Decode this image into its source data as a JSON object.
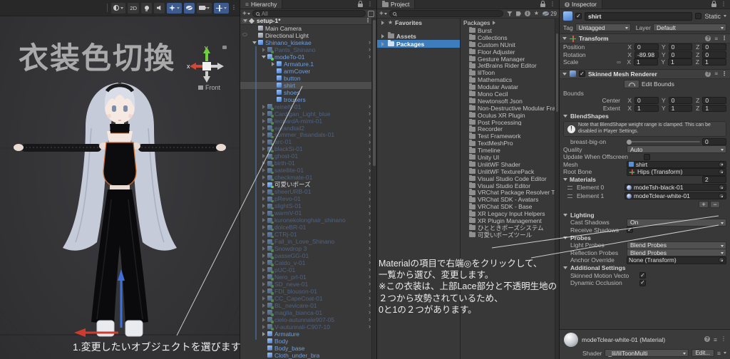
{
  "scene": {
    "title_overlay": "衣装色切換",
    "caption": "1.変更したいオブジェクトを選びます",
    "toolbar": {
      "mode_2d": "2D"
    },
    "view_gizmo": {
      "front": "Front",
      "x": "x",
      "y": "y"
    }
  },
  "hierarchy": {
    "tab": "Hierarchy",
    "search_placeholder": "All",
    "items": [
      {
        "label": "setup-1*",
        "d": 0,
        "s": "scene",
        "e": 1
      },
      {
        "label": "Main Camera",
        "d": 1,
        "s": "plain"
      },
      {
        "label": "Directional Light",
        "d": 1,
        "s": "plain"
      },
      {
        "label": "Shinano_kisekae",
        "d": 1,
        "s": "prefab",
        "e": 1,
        "p": 1
      },
      {
        "label": "Pants_Shinano",
        "d": 2,
        "s": "dim",
        "e": 2,
        "p": 1,
        "b": 1
      },
      {
        "label": "modeTo-01",
        "d": 2,
        "s": "prefab",
        "e": 1,
        "p": 1,
        "b": 1
      },
      {
        "label": "Armature.1",
        "d": 3,
        "s": "prefab",
        "e": 2
      },
      {
        "label": "armCover",
        "d": 3,
        "s": "prefab"
      },
      {
        "label": "button",
        "d": 3,
        "s": "prefab"
      },
      {
        "label": "shirt",
        "d": 3,
        "s": "prefab",
        "sel": 1
      },
      {
        "label": "shoes",
        "d": 3,
        "s": "prefab"
      },
      {
        "label": "trousers",
        "d": 3,
        "s": "prefab"
      },
      {
        "label": "reineN-01",
        "d": 2,
        "s": "dim",
        "e": 2,
        "p": 1,
        "b": 1
      },
      {
        "label": "Cardigan_Light_blue",
        "d": 2,
        "s": "dim",
        "e": 2,
        "p": 1,
        "b": 1
      },
      {
        "label": "leopardA-mimi-01",
        "d": 2,
        "s": "dim",
        "e": 2,
        "p": 1,
        "b": 1
      },
      {
        "label": "earandtail2",
        "d": 2,
        "s": "dim",
        "e": 2,
        "p": 1,
        "b": 1
      },
      {
        "label": "summer_thsandals-01",
        "d": 2,
        "s": "dim",
        "e": 2,
        "p": 1,
        "b": 1
      },
      {
        "label": "arc-01",
        "d": 2,
        "s": "dim",
        "e": 2,
        "p": 1,
        "b": 1
      },
      {
        "label": "blackSi-01",
        "d": 2,
        "s": "dim",
        "e": 2,
        "p": 1,
        "b": 1
      },
      {
        "label": "ghost-01",
        "d": 2,
        "s": "dim",
        "e": 2,
        "p": 1,
        "b": 1
      },
      {
        "label": "birth-01",
        "d": 2,
        "s": "dim",
        "e": 2,
        "p": 1,
        "b": 1
      },
      {
        "label": "satellite-01",
        "d": 2,
        "s": "dim",
        "e": 2,
        "p": 1,
        "b": 1
      },
      {
        "label": "checkmate-01",
        "d": 2,
        "s": "dim",
        "e": 2,
        "p": 1,
        "b": 1
      },
      {
        "label": "可愛いポーズ",
        "d": 2,
        "s": "white",
        "e": 2,
        "p": 1,
        "b": 1
      },
      {
        "label": "sheerURB-01",
        "d": 2,
        "s": "dim",
        "e": 2,
        "p": 1,
        "b": 1
      },
      {
        "label": "pRevo-01",
        "d": 2,
        "s": "dim",
        "e": 2,
        "p": 1,
        "b": 1
      },
      {
        "label": "slightS-01",
        "d": 2,
        "s": "dim",
        "e": 2,
        "p": 1,
        "b": 1
      },
      {
        "label": "warmV-01",
        "d": 2,
        "s": "dim",
        "e": 2,
        "p": 1,
        "b": 1
      },
      {
        "label": "kuronekolonghair_shinano",
        "d": 2,
        "s": "dim",
        "e": 2,
        "p": 1,
        "b": 1
      },
      {
        "label": "dolceBR-01",
        "d": 2,
        "s": "dim",
        "e": 2,
        "p": 1,
        "b": 1
      },
      {
        "label": "CTRj-01",
        "d": 2,
        "s": "dim",
        "e": 2,
        "p": 1,
        "b": 1
      },
      {
        "label": "Fall_in_Love_Shinano",
        "d": 2,
        "s": "dim",
        "e": 2,
        "p": 1,
        "b": 1
      },
      {
        "label": "Snowdrop 3",
        "d": 2,
        "s": "dim",
        "e": 2,
        "p": 1,
        "b": 1
      },
      {
        "label": "passeGG-01",
        "d": 2,
        "s": "dim",
        "e": 2,
        "p": 1,
        "b": 1
      },
      {
        "label": "Caldo_v-01",
        "d": 2,
        "s": "dim",
        "e": 2,
        "p": 1,
        "b": 1
      },
      {
        "label": "pUC-01",
        "d": 2,
        "s": "dim",
        "e": 2,
        "p": 1,
        "b": 1
      },
      {
        "label": "Nero_prl-01",
        "d": 2,
        "s": "dim",
        "e": 2,
        "p": 1,
        "b": 1
      },
      {
        "label": "SD_neve-01",
        "d": 2,
        "s": "dim",
        "e": 2,
        "p": 1,
        "b": 1
      },
      {
        "label": "FDl_blouson-01",
        "d": 2,
        "s": "dim",
        "e": 2,
        "p": 1,
        "b": 1
      },
      {
        "label": "CC_CapeCoat-01",
        "d": 2,
        "s": "dim",
        "e": 2,
        "p": 1,
        "b": 1
      },
      {
        "label": "BL_nevicare-01",
        "d": 2,
        "s": "dim",
        "e": 2,
        "p": 1,
        "b": 1
      },
      {
        "label": "maglia_bianca-01",
        "d": 2,
        "s": "dim",
        "e": 2,
        "p": 1,
        "b": 1
      },
      {
        "label": "cielo-autunnale907-05",
        "d": 2,
        "s": "dim",
        "e": 2,
        "p": 1,
        "b": 1
      },
      {
        "label": "V-autunnali-C907-10",
        "d": 2,
        "s": "dim",
        "e": 2,
        "p": 1,
        "b": 1
      },
      {
        "label": "Armature",
        "d": 2,
        "s": "prefab",
        "e": 2
      },
      {
        "label": "Body",
        "d": 2,
        "s": "prefab"
      },
      {
        "label": "Body_base",
        "d": 2,
        "s": "prefab"
      },
      {
        "label": "Cloth_under_bra",
        "d": 2,
        "s": "prefab"
      }
    ]
  },
  "project": {
    "tab": "Project",
    "hidden_count": "29",
    "tree": [
      {
        "label": "Favorites",
        "icon": "star"
      },
      {
        "label": "Assets",
        "icon": "folder"
      },
      {
        "label": "Packages",
        "icon": "folder",
        "selected": true
      }
    ],
    "breadcrumb": "Packages",
    "packages": [
      "Burst",
      "Collections",
      "Custom NUnit",
      "Floor Adjuster",
      "Gesture Manager",
      "JetBrains Rider Editor",
      "lilToon",
      "Mathematics",
      "Modular Avatar",
      "Mono Cecil",
      "Newtonsoft Json",
      "Non-Destructive Modular Framework",
      "Oculus XR Plugin",
      "Post Processing",
      "Recorder",
      "Test Framework",
      "TextMeshPro",
      "Timeline",
      "Unity UI",
      "UnlitWF Shader",
      "UnlitWF TexturePack",
      "Visual Studio Code Editor",
      "Visual Studio Editor",
      "VRChat Package Resolver Tool",
      "VRChat SDK - Avatars",
      "VRChat SDK - Base",
      "XR Legacy Input Helpers",
      "XR Plugin Management",
      "ひとときポーズシステム",
      "可愛いポーズツール"
    ]
  },
  "inspector": {
    "tab": "Inspector",
    "header": {
      "name": "shirt",
      "static_label": "Static"
    },
    "tag_row": {
      "tag_label": "Tag",
      "tag_value": "Untagged",
      "layer_label": "Layer",
      "layer_value": "Default"
    },
    "axes": {
      "x": "X",
      "y": "Y",
      "z": "Z"
    },
    "transform": {
      "title": "Transform",
      "position_label": "Position",
      "rotation_label": "Rotation",
      "scale_label": "Scale",
      "position": {
        "x": "0",
        "y": "0",
        "z": "0"
      },
      "rotation": {
        "x": "-89.98",
        "y": "0",
        "z": "0"
      },
      "scale": {
        "x": "1",
        "y": "1",
        "z": "1"
      }
    },
    "smr": {
      "title": "Skinned Mesh Renderer",
      "edit_bounds": "Edit Bounds",
      "bounds_label": "Bounds",
      "center_label": "Center",
      "extent_label": "Extent",
      "center": {
        "x": "0",
        "y": "0",
        "z": "0"
      },
      "extent": {
        "x": "1",
        "y": "1",
        "z": "1"
      },
      "blendshapes_label": "BlendShapes",
      "note": "Note that BlendShape weight range is clamped. This can be disabled in Player Settings.",
      "blend_name": "breast-big-on",
      "blend_value": "0",
      "quality_label": "Quality",
      "quality_value": "Auto",
      "offscreen_label": "Update When Offscreen",
      "mesh_label": "Mesh",
      "mesh_value": "shirt",
      "root_bone_label": "Root Bone",
      "root_bone_value": "Hips (Transform)",
      "materials_label": "Materials",
      "materials_size": "2",
      "elements": [
        {
          "label": "Element 0",
          "value": "modeTsh-black-01"
        },
        {
          "label": "Element 1",
          "value": "modeTclear-white-01"
        }
      ],
      "lighting_label": "Lighting",
      "cast_label": "Cast Shadows",
      "cast_value": "On",
      "receive_label": "Receive Shadows",
      "probes_label": "Probes",
      "light_probes_label": "Light Probes",
      "light_probes_value": "Blend Probes",
      "reflection_probes_label": "Reflection Probes",
      "reflection_probes_value": "Blend Probes",
      "anchor_label": "Anchor Override",
      "anchor_value": "None (Transform)",
      "additional_label": "Additional Settings",
      "motion_vectors_label": "Skinned Motion Vecto",
      "occlusion_label": "Dynamic Occlusion"
    },
    "material_footer": {
      "title": "modeTclear-white-01 (Material)",
      "shader_label": "Shader",
      "shader_value": "_lil/lilToonMulti",
      "edit_button": "Edit..."
    }
  },
  "annotations": {
    "material_note_lines": [
      "Materialの項目で右端◎をクリックして、",
      "一覧から選び、変更します。",
      "※この衣装は、上部Lace部分と不透明生地の",
      "２つから攻勢されているため、",
      "0と1の２つがあります。"
    ]
  }
}
